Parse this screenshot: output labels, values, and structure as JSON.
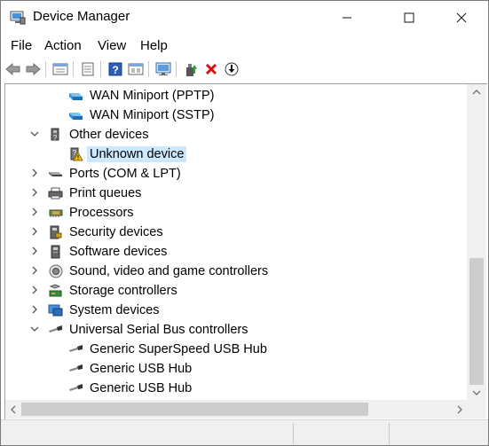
{
  "window": {
    "title": "Device Manager"
  },
  "menu": {
    "file": "File",
    "action": "Action",
    "view": "View",
    "help": "Help"
  },
  "toolbar": {
    "buttons": [
      "back-arrow-icon",
      "forward-arrow-icon",
      "properties-icon",
      "list-icon",
      "help-icon",
      "view-icon",
      "monitor-icon",
      "update-driver-icon",
      "uninstall-icon",
      "disable-device-icon"
    ]
  },
  "tree": {
    "rows": [
      {
        "label": "WAN Miniport (PPTP)",
        "icon": "network-adapter-icon"
      },
      {
        "label": "WAN Miniport (SSTP)",
        "icon": "network-adapter-icon"
      },
      {
        "label": "Other devices",
        "icon": "other-devices-icon",
        "expanded": true
      },
      {
        "label": "Unknown device",
        "icon": "warning-device-icon",
        "selected": true
      },
      {
        "label": "Ports (COM & LPT)",
        "icon": "port-icon"
      },
      {
        "label": "Print queues",
        "icon": "printer-icon"
      },
      {
        "label": "Processors",
        "icon": "processor-icon"
      },
      {
        "label": "Security devices",
        "icon": "security-device-icon"
      },
      {
        "label": "Software devices",
        "icon": "software-device-icon"
      },
      {
        "label": "Sound, video and game controllers",
        "icon": "speaker-icon"
      },
      {
        "label": "Storage controllers",
        "icon": "storage-icon"
      },
      {
        "label": "System devices",
        "icon": "system-icon"
      },
      {
        "label": "Universal Serial Bus controllers",
        "icon": "usb-icon",
        "expanded": true
      },
      {
        "label": "Generic SuperSpeed USB Hub",
        "icon": "usb-plug-icon"
      },
      {
        "label": "Generic USB Hub",
        "icon": "usb-plug-icon"
      },
      {
        "label": "Generic USB Hub",
        "icon": "usb-plug-icon"
      }
    ]
  },
  "colors": {
    "selection": "#cce8ff",
    "accent": "#0078d7"
  }
}
